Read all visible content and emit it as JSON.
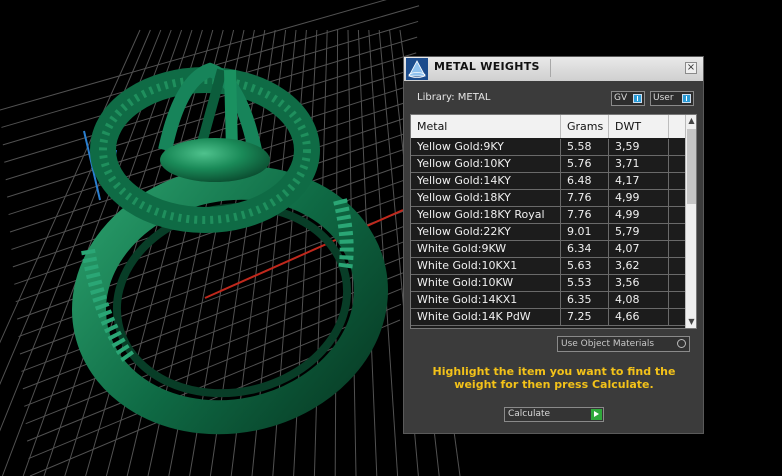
{
  "panel": {
    "title": "METAL WEIGHTS",
    "close_label": "×",
    "library_label": "Library: METAL",
    "toggles": [
      {
        "label": "GV"
      },
      {
        "label": "User"
      }
    ],
    "table": {
      "columns": [
        "Metal",
        "Grams",
        "DWT"
      ],
      "rows": [
        [
          "Yellow Gold:9KY",
          "5.58",
          "3,59"
        ],
        [
          "Yellow Gold:10KY",
          "5.76",
          "3,71"
        ],
        [
          "Yellow Gold:14KY",
          "6.48",
          "4,17"
        ],
        [
          "Yellow Gold:18KY",
          "7.76",
          "4,99"
        ],
        [
          "Yellow Gold:18KY Royal",
          "7.76",
          "4,99"
        ],
        [
          "Yellow Gold:22KY",
          "9.01",
          "5,79"
        ],
        [
          "White Gold:9KW",
          "6.34",
          "4,07"
        ],
        [
          "White Gold:10KX1",
          "5.63",
          "3,62"
        ],
        [
          "White Gold:10KW",
          "5.53",
          "3,56"
        ],
        [
          "White Gold:14KX1",
          "6.35",
          "4,08"
        ],
        [
          "White Gold:14K PdW",
          "7.25",
          "4,66"
        ]
      ]
    },
    "use_object_materials_label": "Use Object Materials",
    "hint": "Highlight the item you want to find the weight for then press Calculate.",
    "calculate_label": "Calculate"
  },
  "colors": {
    "hint_text": "#f3c219",
    "ring_green": "#0f6b45",
    "grid_line": "#5a5a5a",
    "axis_red": "#c0281c",
    "axis_blue": "#2a7fd0",
    "toggle_indicator": "#2a9bd6",
    "calculate_go": "#2fa83b"
  }
}
